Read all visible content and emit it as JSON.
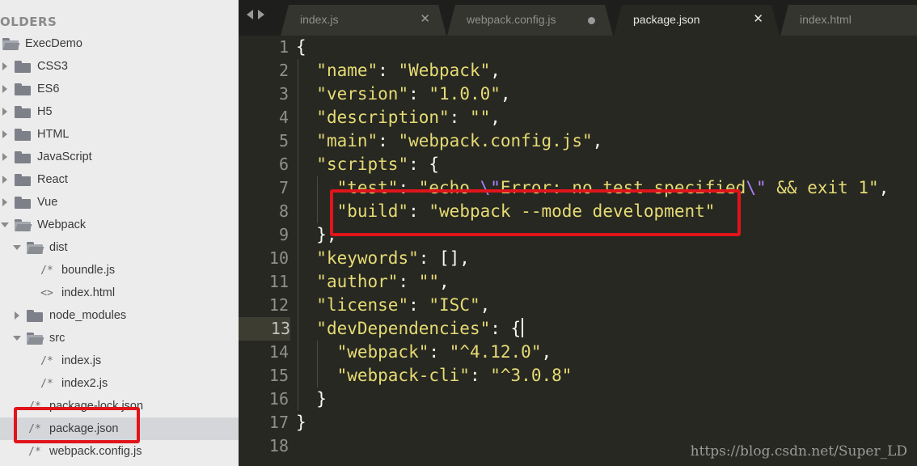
{
  "sidebar": {
    "header": "OLDERS",
    "tree": [
      {
        "label": "ExecDemo",
        "kind": "folder",
        "open": true,
        "depth": 0
      },
      {
        "label": "CSS3",
        "kind": "folder",
        "open": false,
        "depth": 1
      },
      {
        "label": "ES6",
        "kind": "folder",
        "open": false,
        "depth": 1
      },
      {
        "label": "H5",
        "kind": "folder",
        "open": false,
        "depth": 1
      },
      {
        "label": "HTML",
        "kind": "folder",
        "open": false,
        "depth": 1
      },
      {
        "label": "JavaScript",
        "kind": "folder",
        "open": false,
        "depth": 1
      },
      {
        "label": "React",
        "kind": "folder",
        "open": false,
        "depth": 1
      },
      {
        "label": "Vue",
        "kind": "folder",
        "open": false,
        "depth": 1
      },
      {
        "label": "Webpack",
        "kind": "folder",
        "open": true,
        "depth": 1
      },
      {
        "label": "dist",
        "kind": "folder",
        "open": true,
        "depth": 2
      },
      {
        "label": "boundle.js",
        "kind": "file",
        "icon": "/*",
        "depth": 3
      },
      {
        "label": "index.html",
        "kind": "file",
        "icon": "<>",
        "depth": 3
      },
      {
        "label": "node_modules",
        "kind": "folder",
        "open": false,
        "depth": 2
      },
      {
        "label": "src",
        "kind": "folder",
        "open": true,
        "depth": 2
      },
      {
        "label": "index.js",
        "kind": "file",
        "icon": "/*",
        "depth": 3
      },
      {
        "label": "index2.js",
        "kind": "file",
        "icon": "/*",
        "depth": 3
      },
      {
        "label": "package-lock.json",
        "kind": "file",
        "icon": "/*",
        "depth": 2
      },
      {
        "label": "package.json",
        "kind": "file",
        "icon": "/*",
        "depth": 2,
        "selected": true
      },
      {
        "label": "webpack.config.js",
        "kind": "file",
        "icon": "/*",
        "depth": 2
      }
    ]
  },
  "tabs": [
    {
      "label": "index.js",
      "state": "close"
    },
    {
      "label": "webpack.config.js",
      "state": "modified"
    },
    {
      "label": "package.json",
      "state": "close",
      "active": true
    },
    {
      "label": "index.html",
      "state": "none"
    }
  ],
  "editor": {
    "current_line": 13,
    "lines": [
      [
        [
          "p",
          "{"
        ]
      ],
      [
        [
          "p",
          "  "
        ],
        [
          "k",
          "\"name\""
        ],
        [
          "p",
          ": "
        ],
        [
          "k",
          "\"Webpack\""
        ],
        [
          "p",
          ","
        ]
      ],
      [
        [
          "p",
          "  "
        ],
        [
          "k",
          "\"version\""
        ],
        [
          "p",
          ": "
        ],
        [
          "k",
          "\"1.0.0\""
        ],
        [
          "p",
          ","
        ]
      ],
      [
        [
          "p",
          "  "
        ],
        [
          "k",
          "\"description\""
        ],
        [
          "p",
          ": "
        ],
        [
          "k",
          "\"\""
        ],
        [
          "p",
          ","
        ]
      ],
      [
        [
          "p",
          "  "
        ],
        [
          "k",
          "\"main\""
        ],
        [
          "p",
          ": "
        ],
        [
          "k",
          "\"webpack.config.js\""
        ],
        [
          "p",
          ","
        ]
      ],
      [
        [
          "p",
          "  "
        ],
        [
          "k",
          "\"scripts\""
        ],
        [
          "p",
          ": {"
        ]
      ],
      [
        [
          "p",
          "    "
        ],
        [
          "k",
          "\"test\""
        ],
        [
          "p",
          ": "
        ],
        [
          "k",
          "\"echo "
        ],
        [
          "esc",
          "\\\""
        ],
        [
          "k",
          "Error: no test specified"
        ],
        [
          "esc",
          "\\\""
        ],
        [
          "k",
          " && exit 1\""
        ],
        [
          "p",
          ","
        ]
      ],
      [
        [
          "p",
          "    "
        ],
        [
          "k",
          "\"build\""
        ],
        [
          "p",
          ": "
        ],
        [
          "k",
          "\"webpack --mode development\""
        ]
      ],
      [
        [
          "p",
          "  },"
        ]
      ],
      [
        [
          "p",
          "  "
        ],
        [
          "k",
          "\"keywords\""
        ],
        [
          "p",
          ": [],"
        ]
      ],
      [
        [
          "p",
          "  "
        ],
        [
          "k",
          "\"author\""
        ],
        [
          "p",
          ": "
        ],
        [
          "k",
          "\"\""
        ],
        [
          "p",
          ","
        ]
      ],
      [
        [
          "p",
          "  "
        ],
        [
          "k",
          "\"license\""
        ],
        [
          "p",
          ": "
        ],
        [
          "k",
          "\"ISC\""
        ],
        [
          "p",
          ","
        ]
      ],
      [
        [
          "p",
          "  "
        ],
        [
          "k",
          "\"devDependencies\""
        ],
        [
          "p",
          ": {"
        ]
      ],
      [
        [
          "p",
          "    "
        ],
        [
          "k",
          "\"webpack\""
        ],
        [
          "p",
          ": "
        ],
        [
          "k",
          "\"^4.12.0\""
        ],
        [
          "p",
          ","
        ]
      ],
      [
        [
          "p",
          "    "
        ],
        [
          "k",
          "\"webpack-cli\""
        ],
        [
          "p",
          ": "
        ],
        [
          "k",
          "\"^3.0.8\""
        ]
      ],
      [
        [
          "p",
          "  }"
        ]
      ],
      [
        [
          "p",
          "}"
        ]
      ],
      [
        [
          "p",
          ""
        ]
      ]
    ]
  },
  "watermark": "https://blog.csdn.net/Super_LD",
  "colors": {
    "annotation": "#e0141a",
    "string": "#e6db74",
    "escape": "#ae81ff",
    "background": "#272822"
  }
}
